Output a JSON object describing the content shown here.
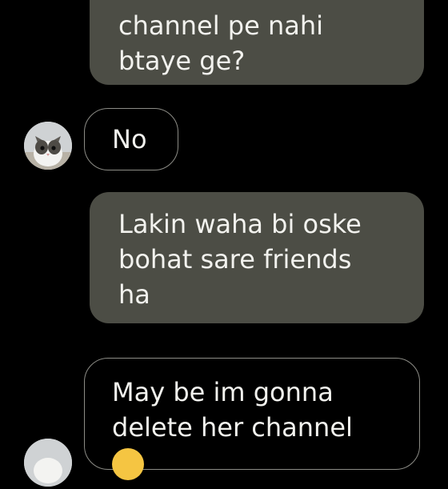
{
  "messages": [
    {
      "direction": "outgoing",
      "lines": [
        "channel pe nahi",
        "btaye ge?"
      ]
    },
    {
      "direction": "incoming",
      "lines": [
        "No"
      ]
    },
    {
      "direction": "outgoing",
      "lines": [
        "Lakin waha bi oske",
        "bohat sare friends",
        "ha"
      ]
    },
    {
      "direction": "incoming",
      "lines": [
        "May be im gonna",
        "delete her channel"
      ]
    }
  ],
  "colors": {
    "background": "#000000",
    "outgoing_bubble": "#4c4d45",
    "incoming_border": "#8c8c86",
    "text": "#f2f2ee"
  },
  "icons": {
    "avatar": "cat-avatar-icon",
    "emoji": "emoji-icon"
  }
}
